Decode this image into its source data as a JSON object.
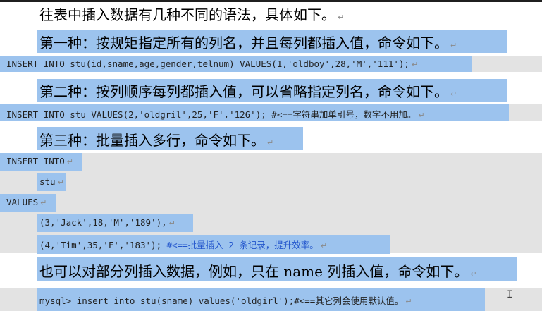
{
  "paragraph_mark": "↵",
  "intro": "往表中插入数据有几种不同的语法，具体如下。",
  "method1": {
    "heading": "第一种：按规矩指定所有的列名，并且每列都插入值，命令如下。",
    "code": "INSERT INTO stu(id,sname,age,gender,telnum) VALUES(1,'oldboy',28,'M','111');"
  },
  "method2": {
    "heading": "第二种：按列顺序每列都插入值，可以省略指定列名，命令如下。",
    "code": "INSERT INTO stu VALUES(2,'oldgril',25,'F','126');",
    "comment": "#<==字符串加单引号，数字不用加。"
  },
  "method3": {
    "heading": "第三种：批量插入多行，命令如下。",
    "code_lines": [
      "INSERT INTO",
      "stu",
      "VALUES",
      "(3,'Jack',18,'M','189'),",
      "(4,'Tim',35,'F','183');"
    ],
    "comment": "#<==批量插入 2 条记录，提升效率。"
  },
  "partial": {
    "text": "也可以对部分列插入数据，例如，只在 name 列插入值，命令如下。",
    "code": "mysql> insert into stu(sname) values('oldgirl');",
    "comment": "#<==其它列会使用默认值。"
  },
  "cursor_glyph": "I"
}
